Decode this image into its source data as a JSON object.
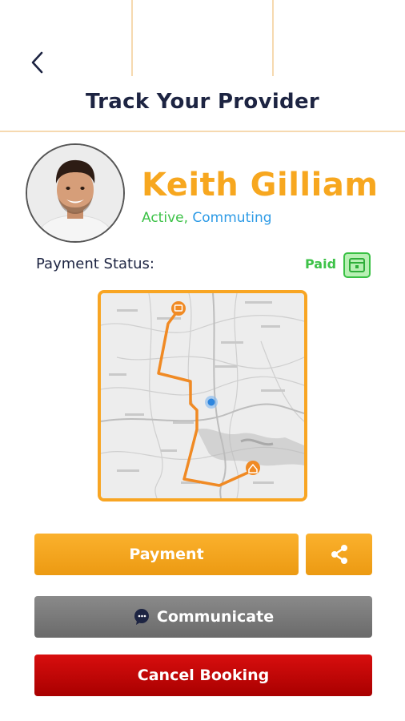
{
  "header": {
    "title": "Track Your Provider",
    "back_icon": "chevron-left-icon"
  },
  "provider": {
    "name": "Keith Gilliam",
    "status_active": "Active,",
    "status_commuting": "Commuting",
    "avatar": "provider-avatar"
  },
  "payment": {
    "label": "Payment Status:",
    "status": "Paid",
    "status_icon": "wallet-icon"
  },
  "map": {
    "route_color": "#f08a24",
    "start_marker": "store-pin-icon",
    "end_marker": "home-pin-icon",
    "current_location": "location-dot-icon"
  },
  "actions": {
    "payment_label": "Payment",
    "share_icon": "share-icon",
    "communicate_label": "Communicate",
    "communicate_icon": "chat-bubble-icon",
    "cancel_label": "Cancel Booking"
  },
  "colors": {
    "accent": "#f7a71f",
    "title": "#1d2442",
    "active": "#3dc248",
    "commuting": "#2e9be6",
    "cancel": "#c80000",
    "communicate": "#7a7a7a"
  }
}
